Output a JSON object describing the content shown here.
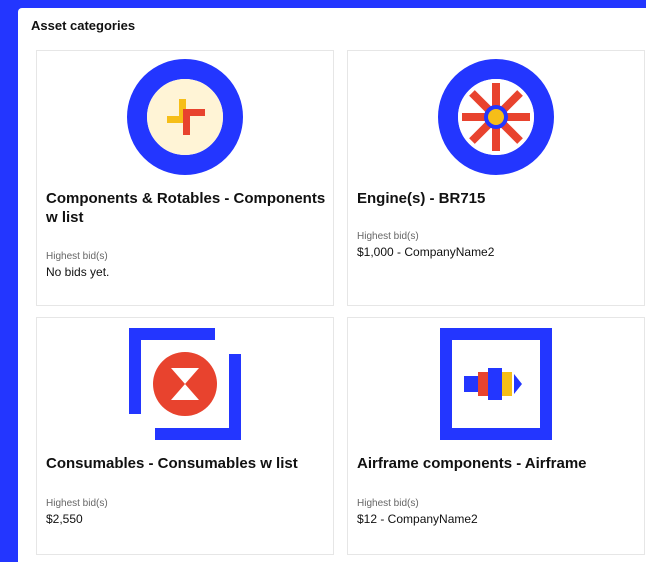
{
  "section": {
    "title": "Asset categories"
  },
  "categories": [
    {
      "title": "Components & Rotables - Components w list",
      "bid_label": "Highest bid(s)",
      "bid_value": "No bids yet.",
      "icon": "components-rotables-icon"
    },
    {
      "title": "Engine(s) - BR715",
      "bid_label": "Highest bid(s)",
      "bid_value": "$1,000 - CompanyName2",
      "icon": "engine-icon"
    },
    {
      "title": "Consumables - Consumables w list",
      "bid_label": "Highest bid(s)",
      "bid_value": "$2,550",
      "icon": "consumables-icon"
    },
    {
      "title": "Airframe components - Airframe",
      "bid_label": "Highest bid(s)",
      "bid_value": "$12 - CompanyName2",
      "icon": "airframe-icon"
    }
  ],
  "colors": {
    "brand_blue": "#2336ff",
    "accent_red": "#e8432e",
    "accent_yellow": "#f6be18",
    "icon_fill_light": "#fff4d6"
  }
}
